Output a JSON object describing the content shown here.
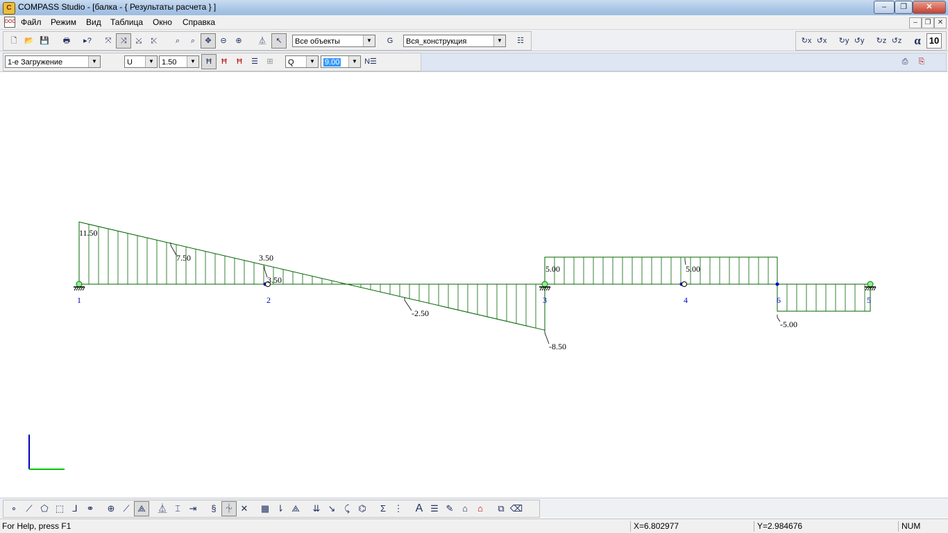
{
  "window": {
    "title": "COMPASS  Studio - [балка - { Результаты расчета } ]",
    "minimize": "–",
    "maximize": "❐",
    "close": "✕"
  },
  "menu": {
    "items": [
      "Файл",
      "Режим",
      "Вид",
      "Таблица",
      "Окно",
      "Справка"
    ],
    "mdi_min": "–",
    "mdi_restore": "❐",
    "mdi_close": "✕"
  },
  "toolbar1": {
    "objects_select": "Все объекты",
    "construction_select": "Вся_конструкция",
    "alpha_label": "α",
    "alpha_value": "10"
  },
  "toolbar2": {
    "load_case": "1-е Загружение",
    "component": "U",
    "scale": "1.50",
    "force_type": "Q",
    "force_value": "9.00"
  },
  "diagram": {
    "nodes": [
      {
        "id": "1",
        "x_label": "1"
      },
      {
        "id": "2",
        "x_label": "2"
      },
      {
        "id": "3",
        "x_label": "3"
      },
      {
        "id": "4",
        "x_label": "4"
      },
      {
        "id": "6",
        "x_label": "6"
      },
      {
        "id": "5",
        "x_label": "5"
      }
    ],
    "value_labels": [
      "11.50",
      "7.50",
      "3.50",
      "3.50",
      "-2.50",
      "-8.50",
      "5.00",
      "5.00",
      "-5.00"
    ],
    "colors": {
      "diagram": "#006400",
      "nodes": "#0000c0",
      "axis_x": "#00c800",
      "axis_y": "#0000c0"
    }
  },
  "status": {
    "help": "For Help, press F1",
    "x": "X=6.802977",
    "y": "Y=2.984676",
    "num": "NUM"
  }
}
